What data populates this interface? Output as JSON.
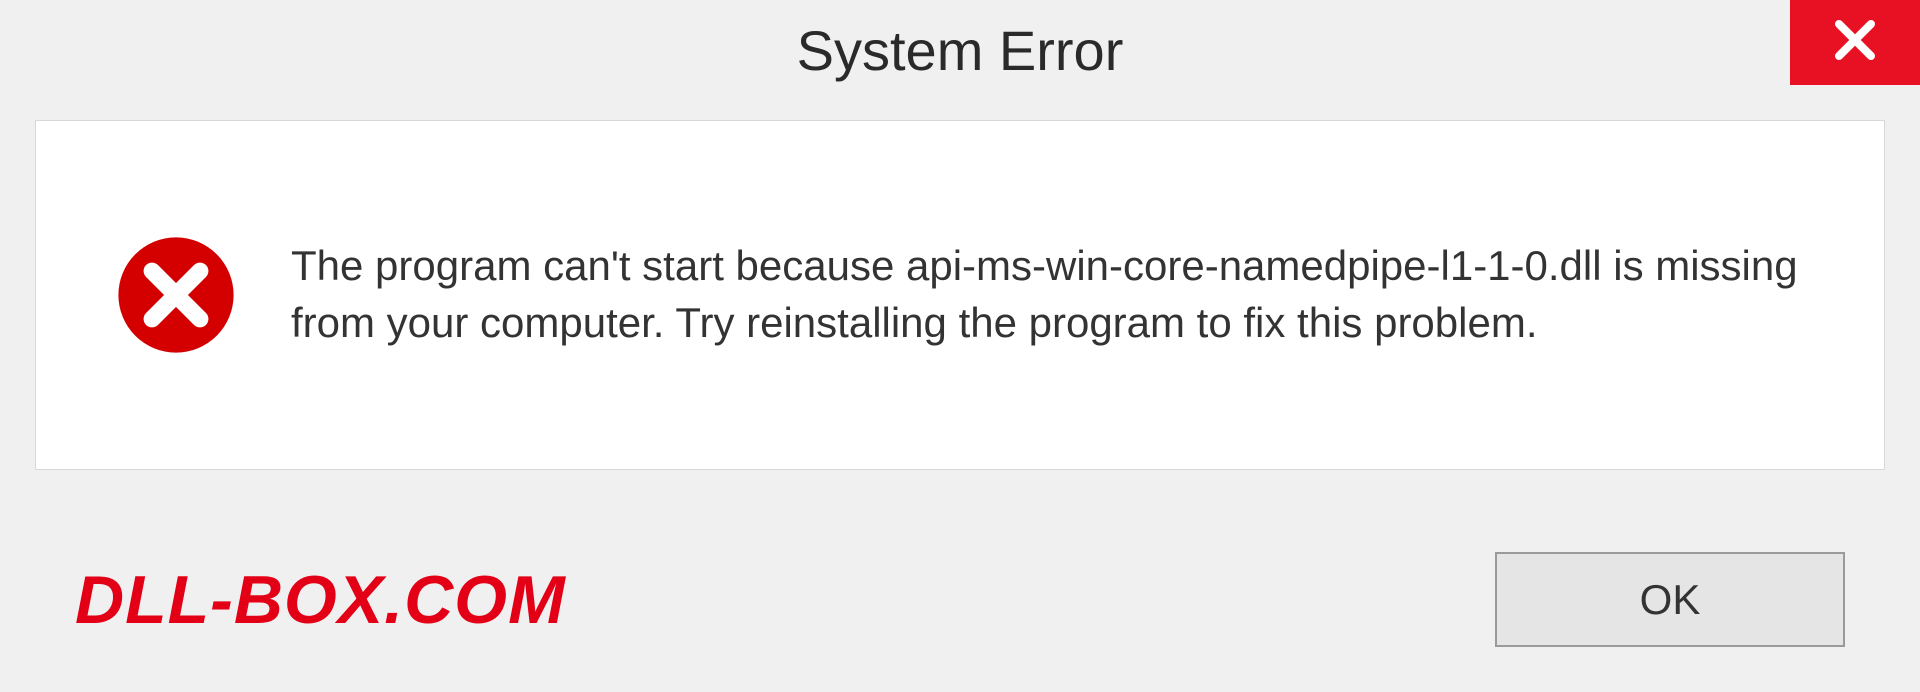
{
  "dialog": {
    "title": "System Error",
    "message": "The program can't start because api-ms-win-core-namedpipe-l1-1-0.dll is missing from your computer. Try reinstalling the program to fix this problem.",
    "ok_label": "OK"
  },
  "watermark": "DLL-BOX.COM",
  "colors": {
    "close_bg": "#e81123",
    "error_red": "#d40000",
    "watermark_red": "#e30016"
  }
}
